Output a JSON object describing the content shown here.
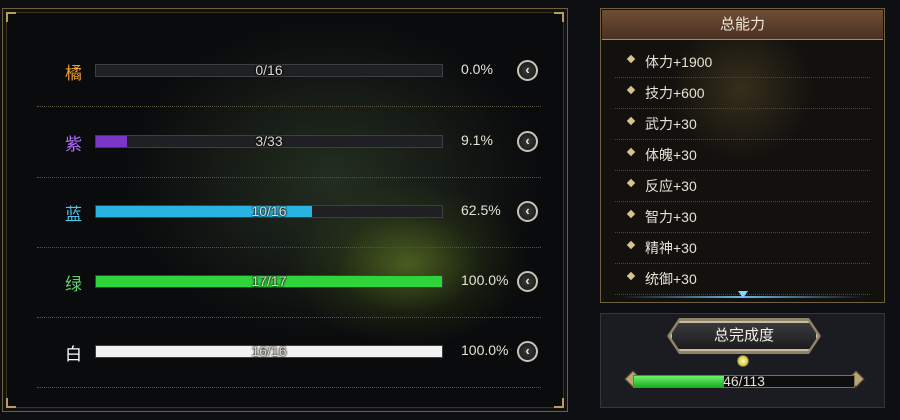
{
  "colors": {
    "orange": "#f0a030",
    "purple": "#b36cff",
    "blue": "#4fc3ea",
    "green": "#5fd46a",
    "white": "#ffffff"
  },
  "rarity_rows": [
    {
      "label": "橘",
      "count": "0/16",
      "percent": "0.0%",
      "progress": 0.0,
      "fill_color": "#f0a030",
      "label_color": "#f0a030",
      "arrow": "‹"
    },
    {
      "label": "紫",
      "count": "3/33",
      "percent": "9.1%",
      "progress": 0.091,
      "fill_color": "#7a35c9",
      "label_color": "#b36cff",
      "arrow": "‹"
    },
    {
      "label": "蓝",
      "count": "10/16",
      "percent": "62.5%",
      "progress": 0.625,
      "fill_color": "#29b3e0",
      "label_color": "#4fc3ea",
      "arrow": "‹"
    },
    {
      "label": "绿",
      "count": "17/17",
      "percent": "100.0%",
      "progress": 1.0,
      "fill_color": "#2fd33a",
      "label_color": "#5fd46a",
      "arrow": "‹"
    },
    {
      "label": "白",
      "count": "16/16",
      "percent": "100.0%",
      "progress": 1.0,
      "fill_color": "#f2f2f2",
      "label_color": "#ffffff",
      "arrow": "‹"
    }
  ],
  "abilities": {
    "title": "总能力",
    "items": [
      "体力+1900",
      "技力+600",
      "武力+30",
      "体魄+30",
      "反应+30",
      "智力+30",
      "精神+30",
      "统御+30"
    ]
  },
  "completion": {
    "label": "总完成度",
    "count": "46/113",
    "progress": 0.407
  }
}
